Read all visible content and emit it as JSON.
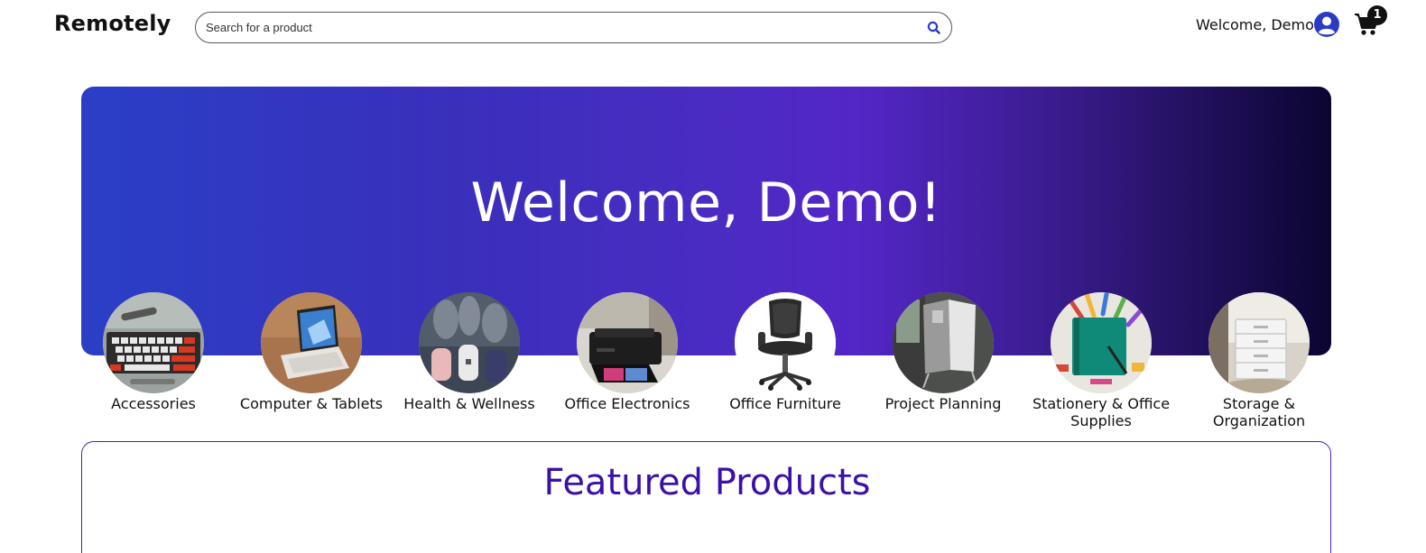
{
  "header": {
    "logo": "Remotely",
    "search_placeholder": "Search for a product",
    "search_icon": "search-icon",
    "welcome_text": "Welcome, Demo",
    "avatar_icon": "user-circle-icon",
    "cart_icon": "shopping-cart-icon",
    "cart_count": "1"
  },
  "hero": {
    "title": "Welcome, Demo!"
  },
  "categories": [
    {
      "label": "Accessories"
    },
    {
      "label": "Computer & Tablets"
    },
    {
      "label": "Health & Wellness"
    },
    {
      "label": "Office Electronics"
    },
    {
      "label": "Office Furniture"
    },
    {
      "label": "Project Planning"
    },
    {
      "label": "Stationery & Office Supplies"
    },
    {
      "label": "Storage & Organization"
    }
  ],
  "featured": {
    "title": "Featured Products"
  },
  "colors": {
    "accent": "#3b10a8",
    "link_blue": "#2b3cc4",
    "hero_start": "#2a3fc6",
    "hero_end": "#0b0530"
  }
}
